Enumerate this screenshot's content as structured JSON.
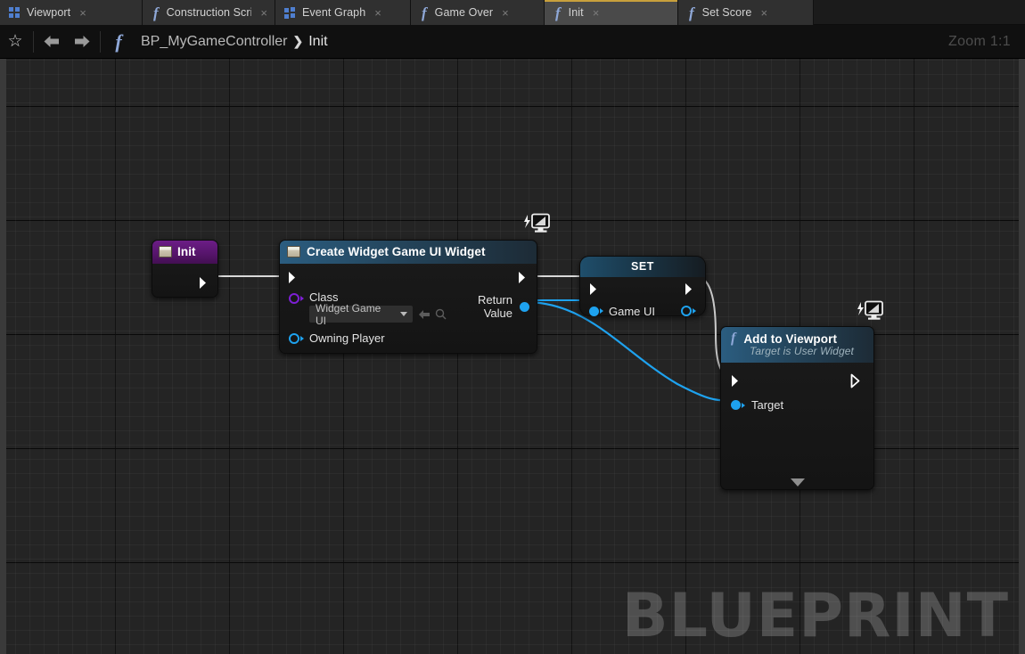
{
  "window": {
    "title": "BP_MyGameController > Init"
  },
  "tabs": [
    {
      "label": "Viewport",
      "icon": "grid-icon",
      "active": false,
      "close": "×"
    },
    {
      "label": "Construction Scrip",
      "icon": "function-icon",
      "active": false,
      "close": "×"
    },
    {
      "label": "Event Graph",
      "icon": "grid-icon",
      "active": false,
      "close": "×"
    },
    {
      "label": "Game Over",
      "icon": "function-icon",
      "active": false,
      "close": "×"
    },
    {
      "label": "Init",
      "icon": "function-icon",
      "active": true,
      "close": "×"
    },
    {
      "label": "Set Score",
      "icon": "function-icon",
      "active": false,
      "close": "×"
    }
  ],
  "toolbar": {
    "favorite_icon": "star-icon",
    "back_icon": "back-arrow-icon",
    "forward_icon": "forward-arrow-icon",
    "graph_icon": "function-icon",
    "breadcrumb_root": "BP_MyGameController",
    "breadcrumb_separator": "❯",
    "breadcrumb_leaf": "Init",
    "zoom_label": "Zoom 1:1"
  },
  "graph": {
    "watermark": "BLUEPRINT",
    "background_color": "#242424",
    "nodes": {
      "event_init": {
        "title": "Init",
        "header_color": "#57156c",
        "exec_out": ""
      },
      "create_widget": {
        "title": "Create Widget Game UI Widget",
        "header_color": "#2b5d80",
        "pins": {
          "class_label": "Class",
          "class_value": "Widget Game UI",
          "owning_player_label": "Owning Player",
          "return_value_label": "Return Value"
        },
        "badge_icon": "latent-monitor-icon"
      },
      "set_node": {
        "title": "SET",
        "header_color": "#1f4e6b",
        "pins": {
          "variable_label": "Game UI"
        }
      },
      "add_to_viewport": {
        "title": "Add to Viewport",
        "subtitle": "Target is User Widget",
        "header_color": "#2b5d80",
        "pins": {
          "target_label": "Target"
        },
        "badge_icon": "latent-monitor-icon",
        "collapse_icon": "chevron-down-icon"
      }
    },
    "wire_colors": {
      "exec": "#d9d9d9",
      "object": "#1ea2ef"
    }
  }
}
